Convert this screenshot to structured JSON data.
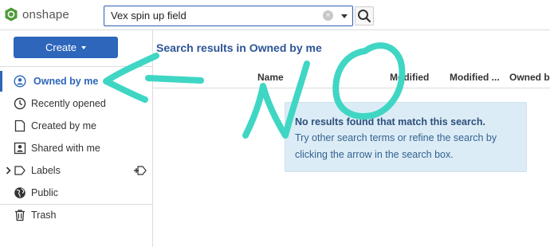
{
  "app": {
    "brand": "onshape"
  },
  "search": {
    "value": "Vex spin up field",
    "clear_glyph": "×"
  },
  "sidebar": {
    "create_label": "Create",
    "items": [
      {
        "label": "Owned by me",
        "icon": "user-circle-icon",
        "active": true
      },
      {
        "label": "Recently opened",
        "icon": "clock-icon"
      },
      {
        "label": "Created by me",
        "icon": "document-icon"
      },
      {
        "label": "Shared with me",
        "icon": "shared-user-icon"
      },
      {
        "label": "Labels",
        "icon": "chevron-right-icon"
      },
      {
        "label": "Public",
        "icon": "globe-icon"
      },
      {
        "label": "Trash",
        "icon": "trash-icon"
      }
    ]
  },
  "main": {
    "results_title": "Search results in Owned by me",
    "columns": [
      "Name",
      "Modified",
      "Modified ...",
      "Owned b"
    ],
    "empty": {
      "title": "No results found that match this search.",
      "lines": [
        "Try other search terms or refine the search by",
        "clicking the arrow in the search box."
      ]
    }
  },
  "annotation": {
    "text": "NO",
    "color": "#3fd6c4"
  },
  "colors": {
    "accent": "#2d66bb",
    "title": "#2d5596",
    "info_bg": "#dcecf6"
  }
}
